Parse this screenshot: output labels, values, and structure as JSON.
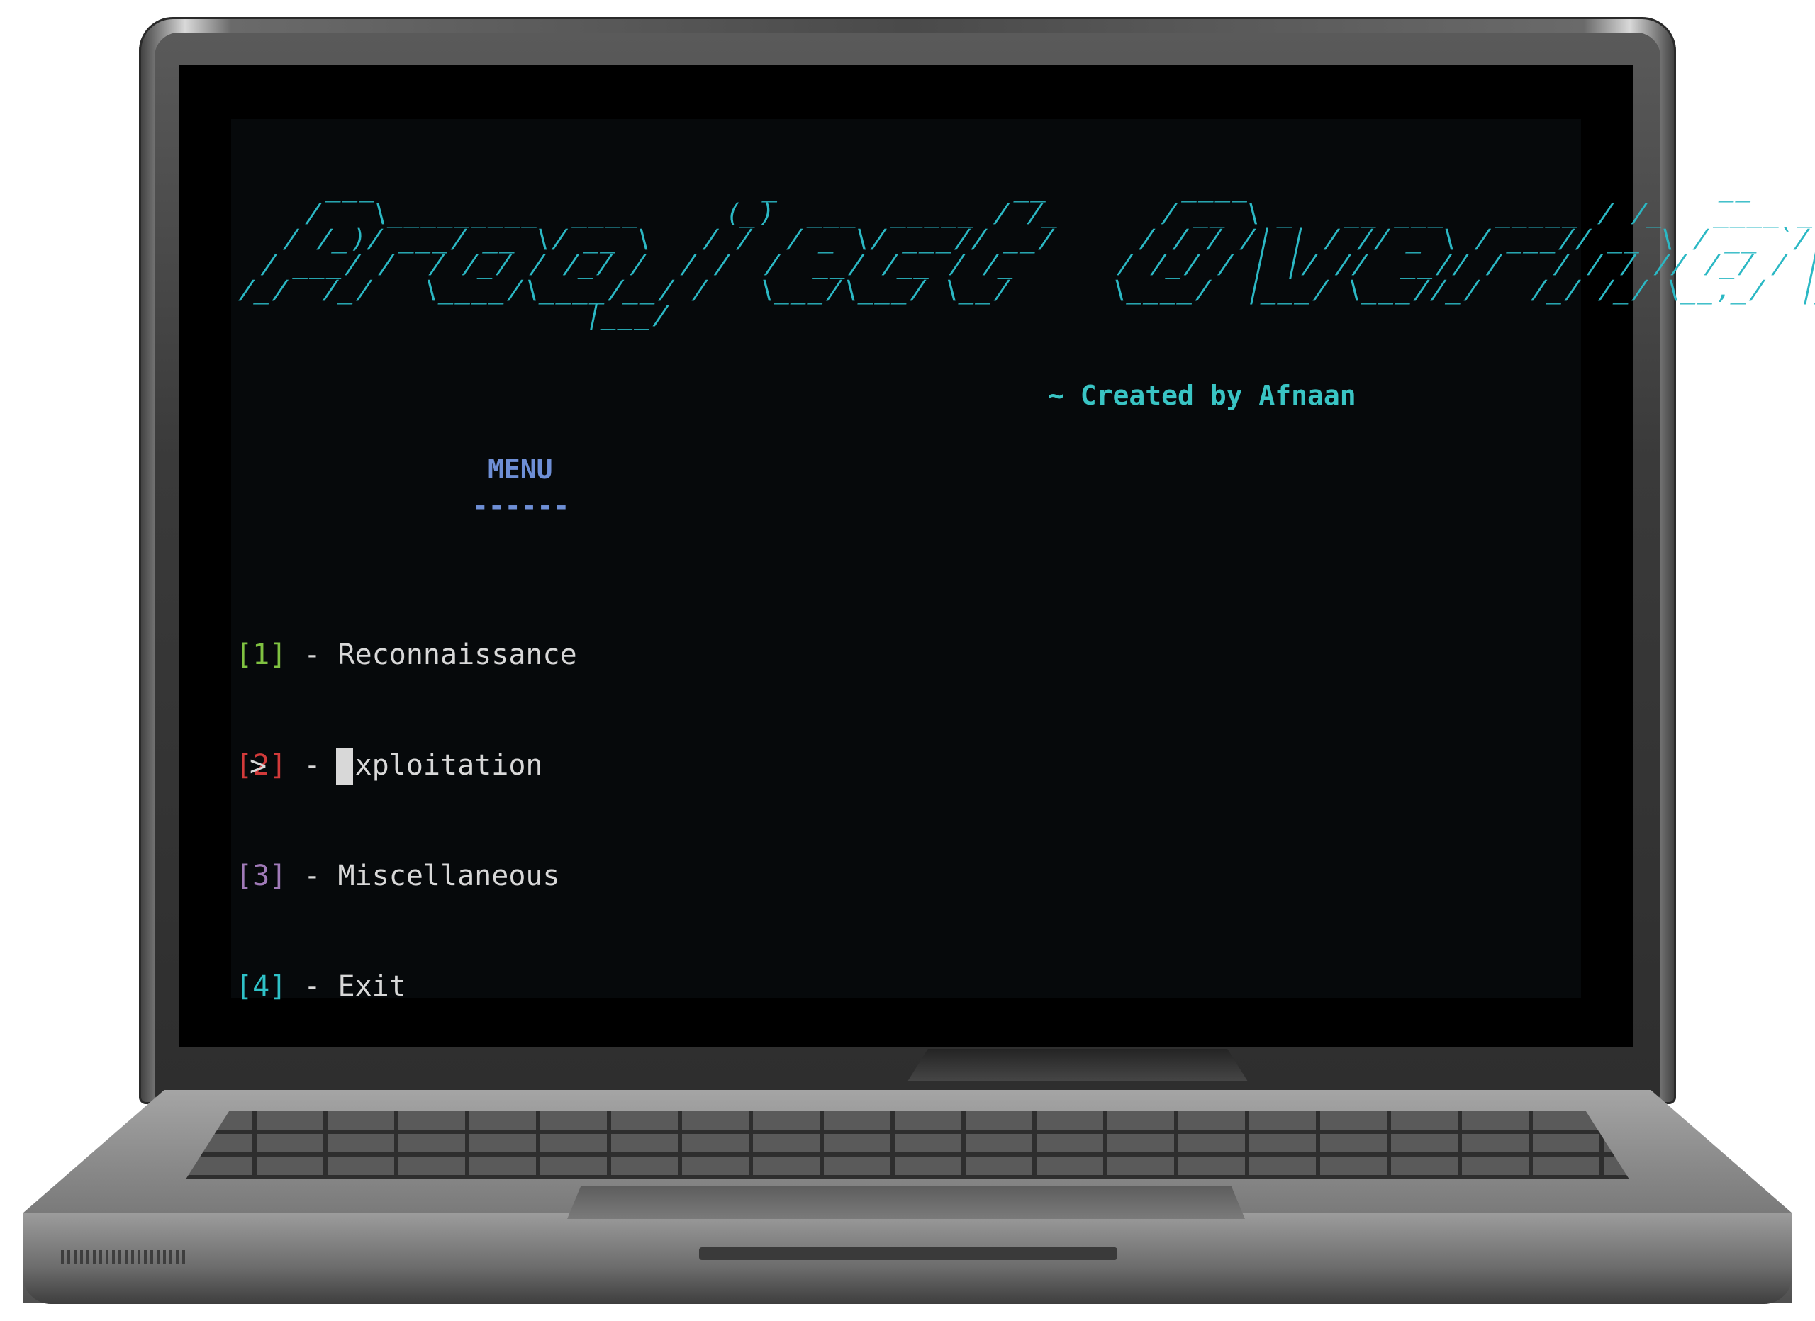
{
  "terminal": {
    "banner_ascii": "    ___                       _              __        ____                            __              __   ____\n   /   \\_________  ____     (_)  ___  _____ / /_      / __ \\ _   __ ___   _____ / /_   ____ _ _     __/ /  / /\n  / /_)/ ___/ __ \\/ __ \\   / /  / _ \\/ ___// __/     / / / /| | / // _ \\ / ___// __ \\ / __ `/| | /| / / /  / /\n / ___/ /  / /_/ / /_/ /  / /  /  __/ /__ / /_      / /_/ / | |/ //  __// /   / / / // /_/ / | |/ |/ / /  /_/\n/_/  /_/   \\____/\\____/__/ /   \\___/\\___/ \\__/      \\____/  |___/ \\___//_/   /_/ /_/ \\__,_/  |__/|__/_/  (_)\n                     |___/",
    "credit": "~ Created by Afnaan",
    "menu_title": "MENU",
    "menu_underline": "------",
    "menu_items": [
      {
        "index": "[1]",
        "label": " - Reconnaissance",
        "index_color": "#7fc241"
      },
      {
        "index": "[2]",
        "label": " - Exploitation",
        "index_color": "#d23a3a"
      },
      {
        "index": "[3]",
        "label": " - Miscellaneous",
        "index_color": "#a07ab8"
      },
      {
        "index": "[4]",
        "label": " - Exit",
        "index_color": "#2fc2c8"
      }
    ],
    "prompt": ">",
    "colors": {
      "banner": "#2bb8c4",
      "credit": "#39c4c4",
      "menu_title": "#6e8fd6",
      "text": "#d8d8d8",
      "background": "#06090b"
    }
  }
}
